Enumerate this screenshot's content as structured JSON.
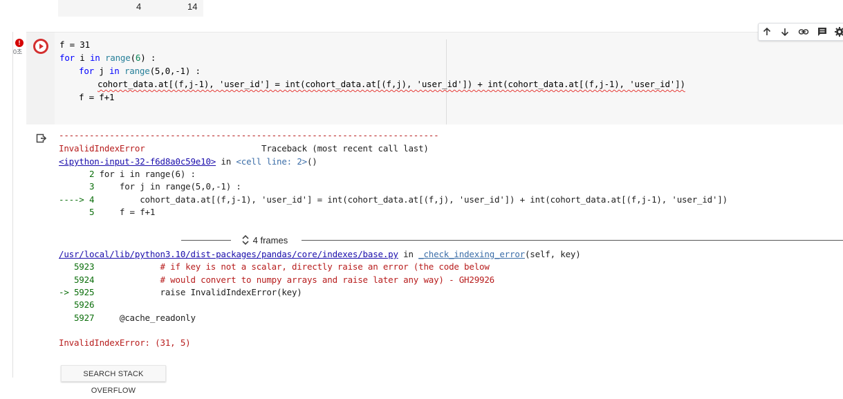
{
  "prev_output": {
    "col_a": "4",
    "col_b": "14"
  },
  "cell": {
    "exec_time": "0초",
    "error_badge": "!",
    "code": {
      "line1": "f = 31",
      "line2_a": "for",
      "line2_b": " i ",
      "line2_c": "in",
      "line2_d": " range",
      "line2_e": "(",
      "line2_f": "6",
      "line2_g": ") :",
      "line3_a": "for",
      "line3_b": " j ",
      "line3_c": "in",
      "line3_d": " range",
      "line3_e": "(5,0,-1) :",
      "line4": "cohort_data.at[(f,j-1), 'user_id'] = int(cohort_data.at[(f,j), 'user_id']) + int(cohort_data.at[(f,j-1), 'user_id'])",
      "line5": "f = f+1"
    }
  },
  "output": {
    "dash_line": "---------------------------------------------------------------------------",
    "error_name": "InvalidIndexError",
    "traceback_label": "Traceback (most recent call last)",
    "input_link": "<ipython-input-32-f6d8a0c59e10>",
    "in_word": " in ",
    "cell_line": "<cell line: 2>",
    "cell_line_suffix": "()",
    "tb_lines": [
      {
        "no": "      2",
        "text": " for i in range(6) :"
      },
      {
        "no": "      3",
        "text": "     for j in range(5,0,-1) :"
      },
      {
        "no": "----> 4",
        "text": "         cohort_data.at[(f,j-1), 'user_id'] = int(cohort_data.at[(f,j), 'user_id']) + int(cohort_data.at[(f,j-1), 'user_id'])"
      },
      {
        "no": "      5",
        "text": "     f = f+1"
      }
    ],
    "frames_label": "4 frames",
    "lib_link": "/usr/local/lib/python3.10/dist-packages/pandas/core/indexes/base.py",
    "lib_in": " in ",
    "lib_func": "_check_indexing_error",
    "lib_args": "(self, key)",
    "lib_lines": [
      {
        "no": "   5923",
        "text": "             # if key is not a scalar, directly raise an error (the code below"
      },
      {
        "no": "   5924",
        "text": "             # would convert to numpy arrays and raise later any way) - GH29926"
      },
      {
        "no": "-> 5925",
        "text": "             raise InvalidIndexError(key)"
      },
      {
        "no": "   5926",
        "text": ""
      },
      {
        "no": "   5927",
        "text": "     @cache_readonly"
      }
    ],
    "final_error": "InvalidIndexError: (31, 5)",
    "so_button": "SEARCH STACK OVERFLOW"
  },
  "toolbar": {
    "icons": [
      "arrow-up-icon",
      "arrow-down-icon",
      "link-icon",
      "comment-icon",
      "gear-icon"
    ]
  }
}
